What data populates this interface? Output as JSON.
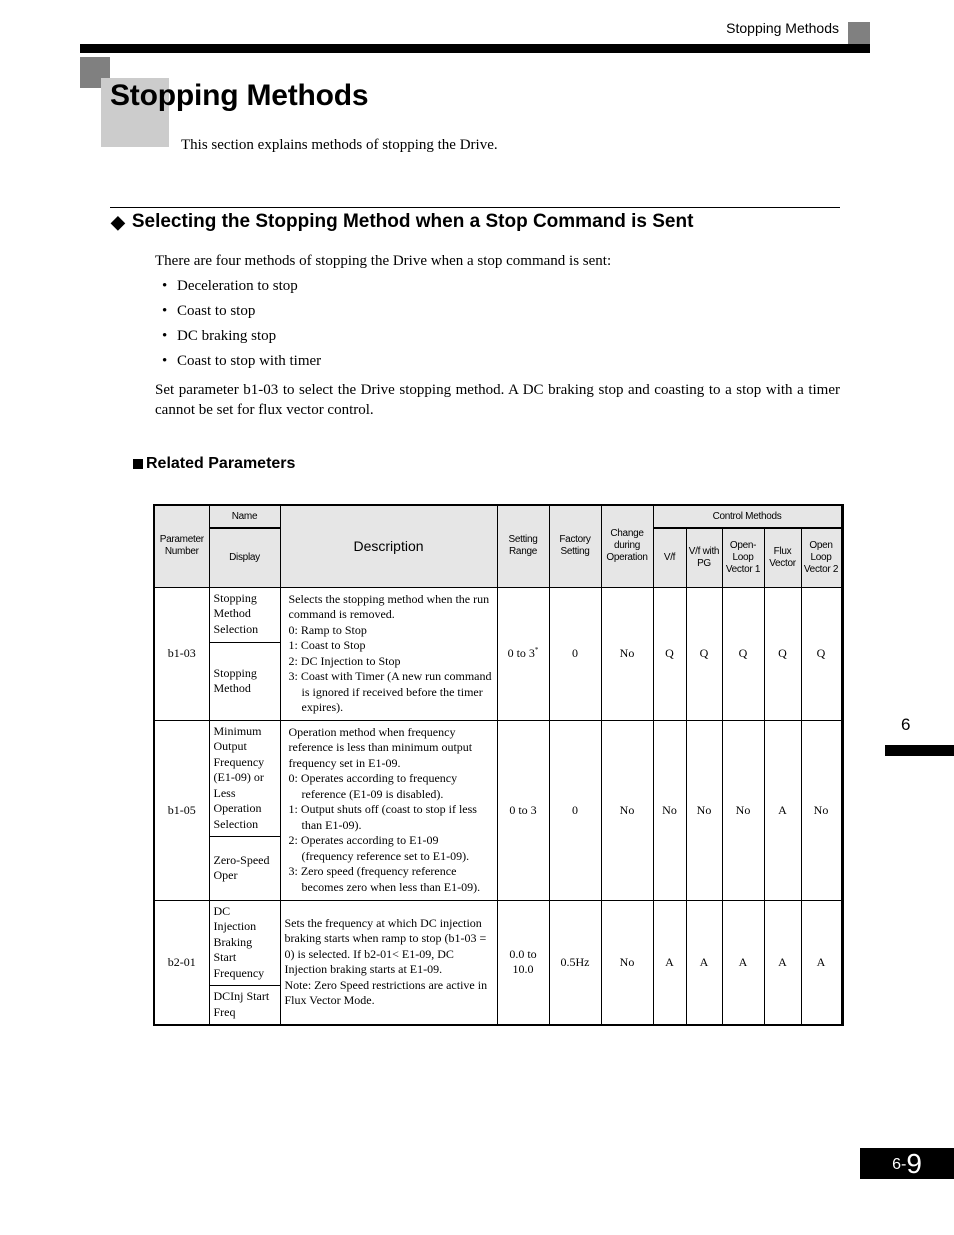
{
  "header": {
    "running_title": "Stopping Methods"
  },
  "page": {
    "title": "Stopping Methods",
    "intro": "This section explains methods of stopping the Drive.",
    "chapter": "6",
    "page_prefix": "6-",
    "page_number": "9"
  },
  "section": {
    "heading": "Selecting the Stopping Method when a Stop Command is Sent",
    "para1": "There are four methods of stopping the Drive when a stop command is sent:",
    "bullets": [
      "Deceleration to stop",
      "Coast to stop",
      "DC braking stop",
      "Coast to stop with timer"
    ],
    "para2": "Set parameter b1-03 to select the Drive stopping method. A DC braking stop and coasting to a stop with a timer cannot be set for flux vector control."
  },
  "related": {
    "heading": "Related Parameters"
  },
  "table": {
    "headers": {
      "param_number": "Parameter Number",
      "name": "Name",
      "display": "Display",
      "description": "Description",
      "setting_range": "Setting Range",
      "factory_setting": "Factory Setting",
      "change_during_operation": "Change during Operation",
      "control_methods": "Control Methods",
      "vf": "V/f",
      "vf_pg": "V/f with PG",
      "olv1": "Open-Loop Vector 1",
      "flux": "Flux Vector",
      "olv2": "Open Loop Vector 2"
    },
    "rows": [
      {
        "param": "b1-03",
        "name": "Stopping Method Selection",
        "display": "Stopping Method",
        "desc": [
          "Selects the stopping method when the run command is removed.",
          "0: Ramp to Stop",
          "1: Coast to Stop",
          "2: DC Injection to Stop",
          "3: Coast with Timer (A new run command is ignored if received before the timer expires)."
        ],
        "range": "0 to 3",
        "range_note": "*",
        "factory": "0",
        "change": "No",
        "methods": [
          "Q",
          "Q",
          "Q",
          "Q",
          "Q"
        ]
      },
      {
        "param": "b1-05",
        "name": "Minimum Output Frequency (E1-09) or Less Operation Selection",
        "display": "Zero-Speed Oper",
        "desc": [
          "Operation method when frequency reference is less than minimum output frequency set in E1-09.",
          "0: Operates according to frequency reference (E1-09 is disabled).",
          "1: Output shuts off (coast to stop if less than E1-09).",
          "2: Operates according to E1-09 (frequency reference set to E1-09).",
          "3: Zero speed (frequency reference becomes zero when less than E1-09)."
        ],
        "range": "0 to 3",
        "range_note": "",
        "factory": "0",
        "change": "No",
        "methods": [
          "No",
          "No",
          "No",
          "A",
          "No"
        ]
      },
      {
        "param": "b2-01",
        "name": "DC Injection Braking Start Frequency",
        "display": "DCInj Start Freq",
        "desc": [
          "Sets the frequency at which DC injection braking starts when ramp to stop (b1-03 = 0) is selected. If b2-01< E1-09, DC Injection braking starts at E1-09.",
          "Note: Zero Speed restrictions are active in Flux Vector Mode."
        ],
        "range": "0.0 to 10.0",
        "range_note": "",
        "factory": "0.5Hz",
        "change": "No",
        "methods": [
          "A",
          "A",
          "A",
          "A",
          "A"
        ]
      }
    ]
  }
}
